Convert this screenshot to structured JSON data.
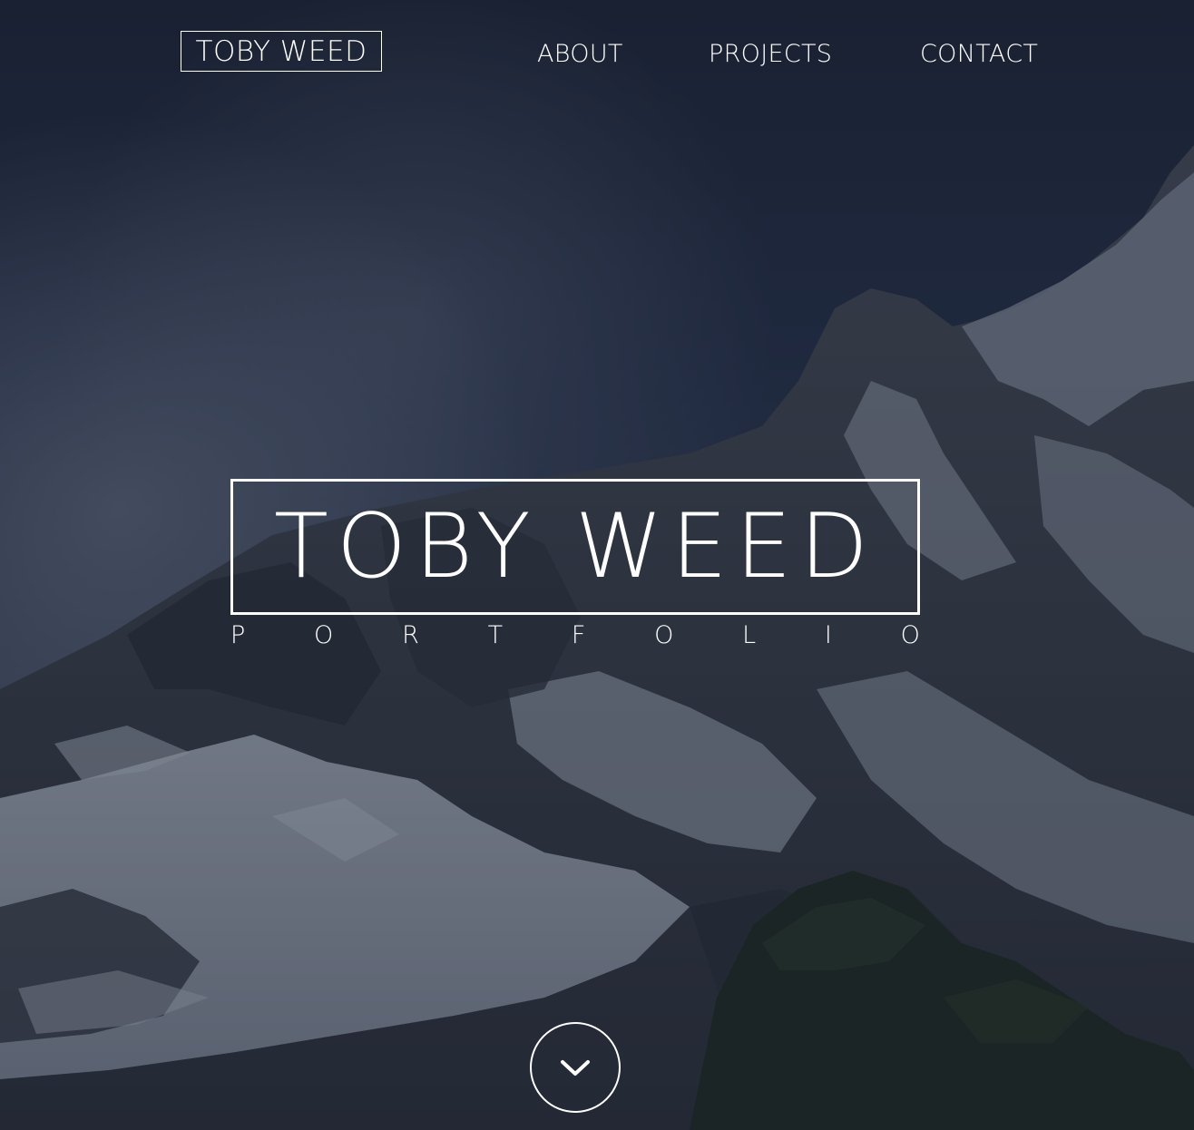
{
  "header": {
    "logo_text": "TOBY WEED"
  },
  "nav": {
    "items": [
      {
        "label": "ABOUT"
      },
      {
        "label": "PROJECTS"
      },
      {
        "label": "CONTACT"
      }
    ]
  },
  "hero": {
    "title": "TOBY WEED",
    "subtitle_letters": [
      "P",
      "O",
      "R",
      "T",
      "F",
      "O",
      "L",
      "I",
      "O"
    ],
    "scroll_icon": "chevron-down-icon"
  },
  "colors": {
    "text": "#ffffff",
    "sky": "#1b2438",
    "overlay": "#141c30"
  }
}
